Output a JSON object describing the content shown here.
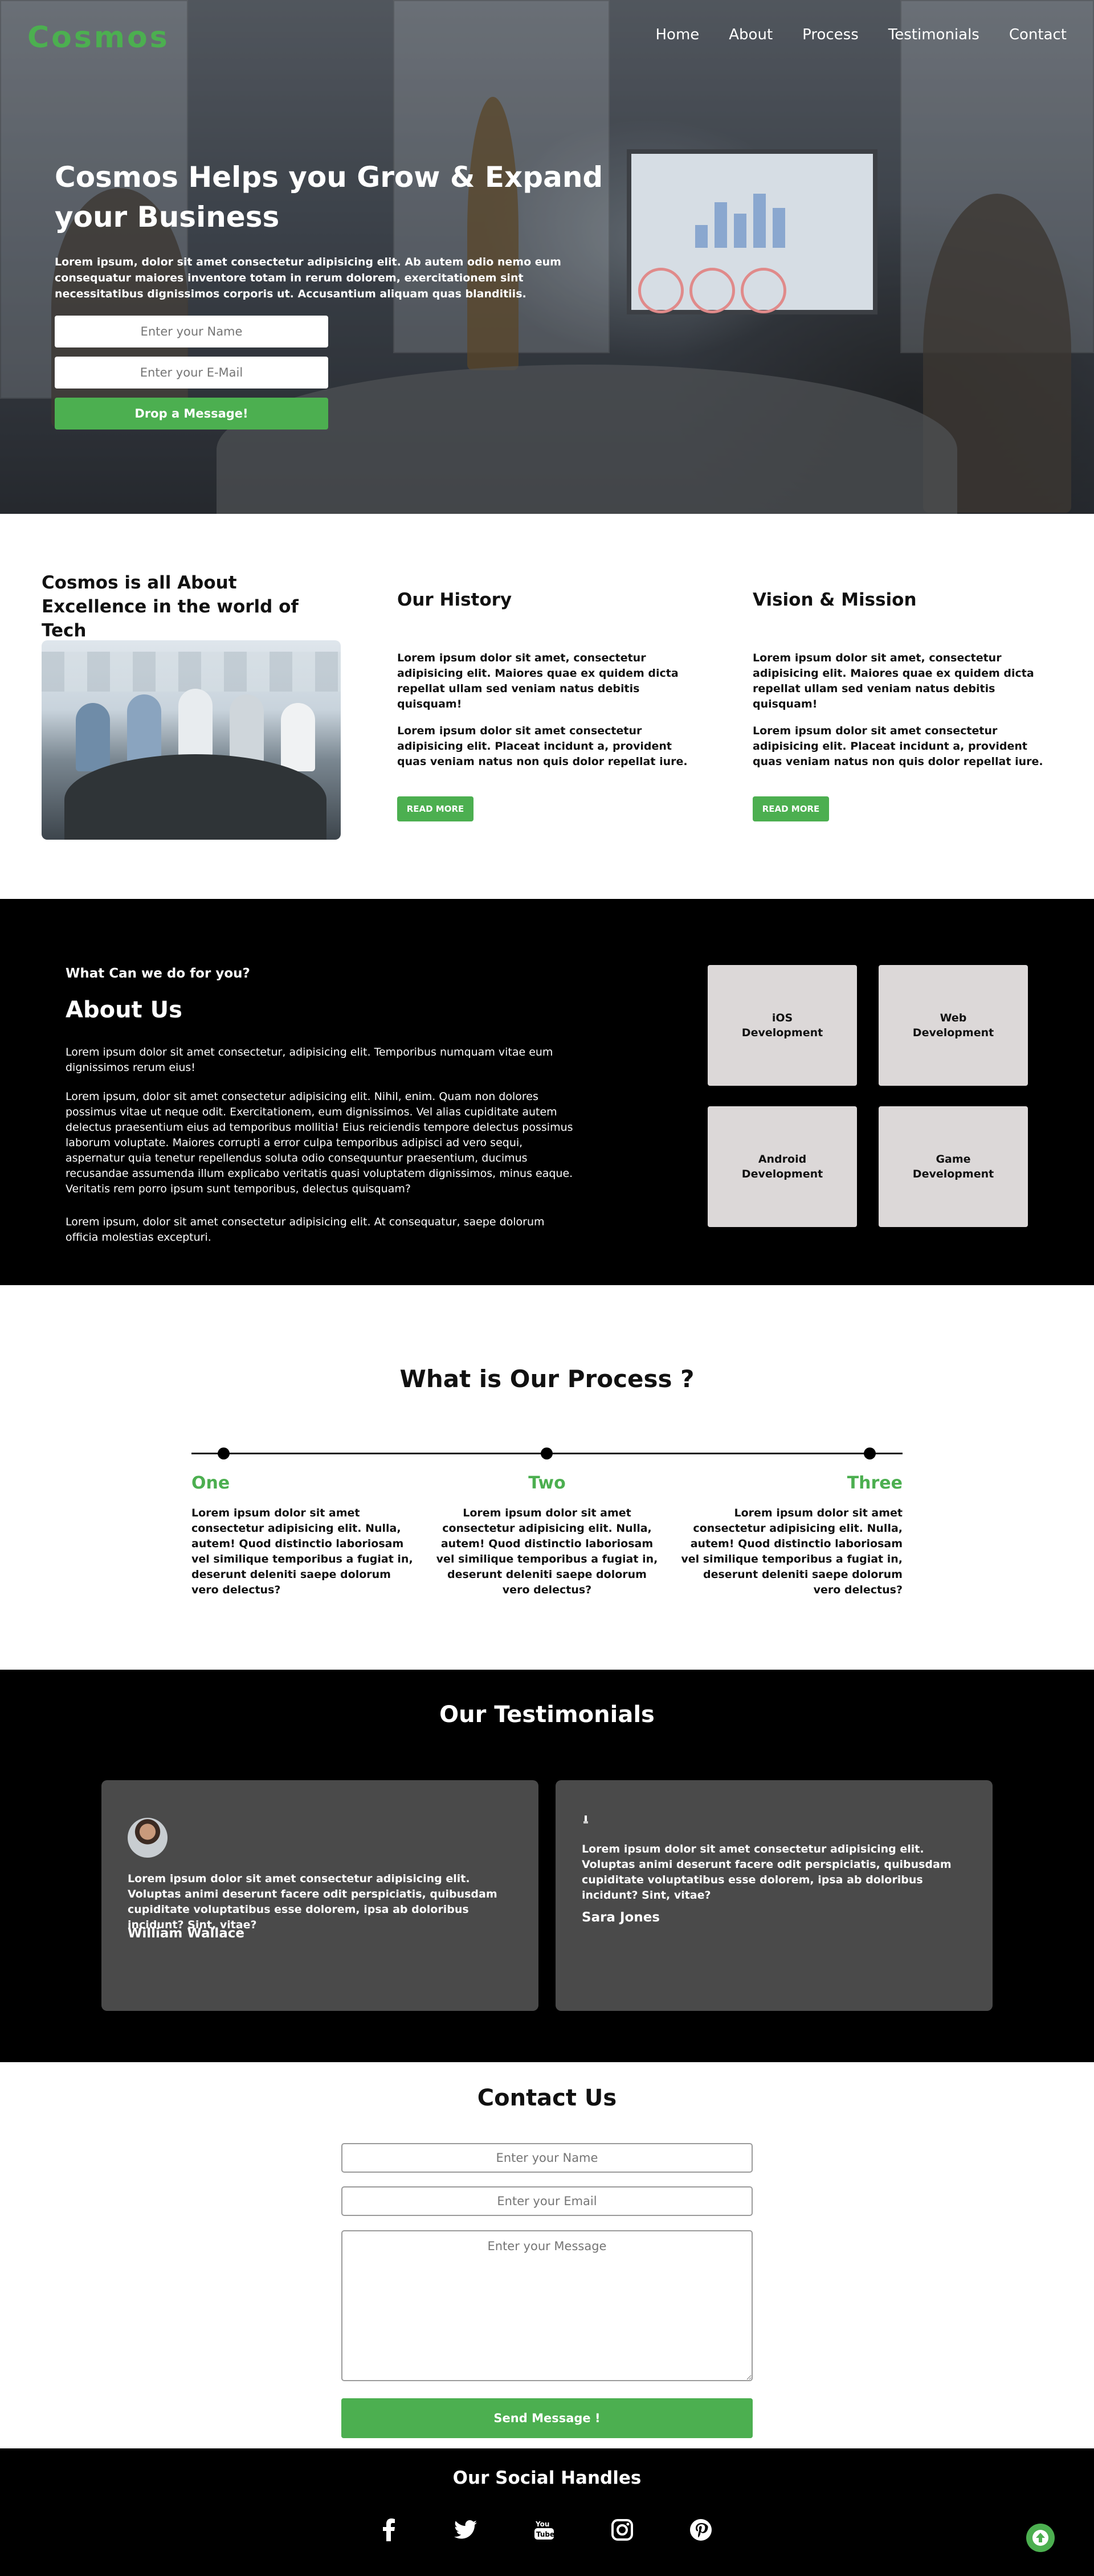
{
  "brand": {
    "logo": "Cosmos",
    "accent": "#4caf50"
  },
  "nav": {
    "items": [
      "Home",
      "About",
      "Process",
      "Testimonials",
      "Contact"
    ]
  },
  "hero": {
    "title": "Cosmos Helps you Grow & Expand your Business",
    "text": "Lorem ipsum, dolor sit amet consectetur adipisicing elit. Ab autem odio nemo eum consequatur maiores inventore totam in rerum dolorem, exercitationem sint necessitatibus dignissimos corporis ut. Accusantium aliquam quas blanditiis.",
    "name_placeholder": "Enter your Name",
    "email_placeholder": "Enter your E-Mail",
    "button": "Drop a Message!"
  },
  "excellence": {
    "heading": "Cosmos is all About Excellence in the world of Tech",
    "history": {
      "title": "Our History",
      "p1": "Lorem ipsum dolor sit amet, consectetur adipisicing elit. Maiores quae ex quidem dicta repellat ullam sed veniam natus debitis quisquam!",
      "p2": "Lorem ipsum dolor sit amet consectetur adipisicing elit. Placeat incidunt a, provident quas veniam natus non quis dolor repellat iure.",
      "button": "READ MORE"
    },
    "vision": {
      "title": "Vision & Mission",
      "p1": "Lorem ipsum dolor sit amet, consectetur adipisicing elit. Maiores quae ex quidem dicta repellat ullam sed veniam natus debitis quisquam!",
      "p2": "Lorem ipsum dolor sit amet consectetur adipisicing elit. Placeat incidunt a, provident quas veniam natus non quis dolor repellat iure.",
      "button": "READ MORE"
    }
  },
  "about": {
    "subtitle": "What Can we do for you?",
    "title": "About Us",
    "p1": "Lorem ipsum dolor sit amet consectetur, adipisicing elit. Temporibus numquam vitae eum dignissimos rerum eius!",
    "p2": "Lorem ipsum, dolor sit amet consectetur adipisicing elit. Nihil, enim. Quam non dolores possimus vitae ut neque odit. Exercitationem, eum dignissimos. Vel alias cupiditate autem delectus praesentium eius ad temporibus mollitia! Eius reiciendis tempore delectus possimus laborum voluptate. Maiores corrupti a error culpa temporibus adipisci ad vero sequi, aspernatur quia tenetur repellendus soluta odio consequuntur praesentium, ducimus recusandae assumenda illum explicabo veritatis quasi voluptatem dignissimos, minus eaque. Veritatis rem porro ipsum sunt temporibus, delectus quisquam?",
    "p3": "Lorem ipsum, dolor sit amet consectetur adipisicing elit. At consequatur, saepe dolorum officia molestias excepturi.",
    "services": [
      "iOS Development",
      "Web Development",
      "Android Development",
      "Game Development"
    ]
  },
  "process": {
    "title": "What is Our Process ?",
    "steps": [
      {
        "label": "One",
        "text": "Lorem ipsum dolor sit amet consectetur adipisicing elit. Nulla, autem! Quod distinctio laboriosam vel similique temporibus a fugiat in, deserunt deleniti saepe dolorum vero delectus?"
      },
      {
        "label": "Two",
        "text": "Lorem ipsum dolor sit amet consectetur adipisicing elit. Nulla, autem! Quod distinctio laboriosam vel similique temporibus a fugiat in, deserunt deleniti saepe dolorum vero delectus?"
      },
      {
        "label": "Three",
        "text": "Lorem ipsum dolor sit amet consectetur adipisicing elit. Nulla, autem! Quod distinctio laboriosam vel similique temporibus a fugiat in, deserunt deleniti saepe dolorum vero delectus?"
      }
    ]
  },
  "testimonials": {
    "title": "Our Testimonials",
    "items": [
      {
        "quote": "Lorem ipsum dolor sit amet consectetur adipisicing elit. Voluptas animi deserunt facere odit perspiciatis, quibusdam cupiditate voluptatibus esse dolorem, ipsa ab doloribus incidunt? Sint, vitae?",
        "name": "William Wallace"
      },
      {
        "quote": "Lorem ipsum dolor sit amet consectetur adipisicing elit. Voluptas animi deserunt facere odit perspiciatis, quibusdam cupiditate voluptatibus esse dolorem, ipsa ab doloribus incidunt? Sint, vitae?",
        "name": "Sara Jones"
      }
    ]
  },
  "contact": {
    "title": "Contact Us",
    "name_placeholder": "Enter your Name",
    "email_placeholder": "Enter your Email",
    "message_placeholder": "Enter your Message",
    "button": "Send Message !"
  },
  "footer": {
    "title": "Our Social Handles",
    "icons": [
      "facebook-icon",
      "twitter-icon",
      "youtube-icon",
      "instagram-icon",
      "pinterest-icon"
    ]
  }
}
